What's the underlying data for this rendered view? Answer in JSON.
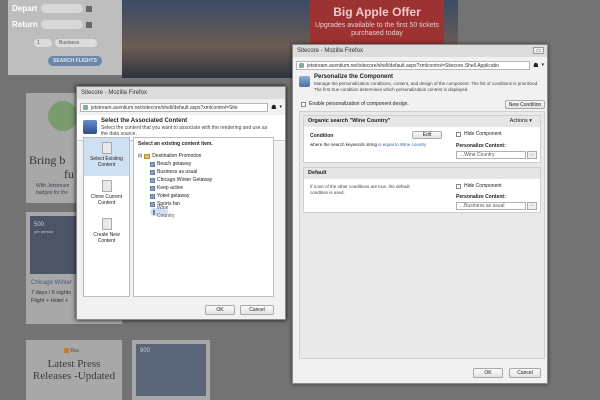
{
  "background": {
    "flight_form": {
      "depart_label": "Depart",
      "return_label": "Return",
      "passengers_value": "1",
      "class_value": "Business",
      "search_button": "SEARCH FLIGHTS"
    },
    "offer": {
      "title": "Big Apple Offer",
      "text": "Upgrades available to the first 50 tickets purchased today"
    },
    "card1": {
      "title_line1": "Bring b",
      "title_line2": "fu",
      "link": "With Jetstream",
      "sub": "badges for the"
    },
    "card2": {
      "price": "500",
      "unit": "per person",
      "title": "Chicago Winter",
      "line1": "7 days / 6 nights",
      "line2": "Flight + Hotel +"
    },
    "press": {
      "rss": "Rss",
      "title": "Latest Press Releases -Updated"
    },
    "card3": {
      "price": "900"
    }
  },
  "associated_dialog": {
    "window_title": "Sitecore - Mozilla Firefox",
    "url": "jetstream.acentium.net/sitecore/shell/default.aspx?xmlcontrol=Site",
    "heading": "Select the Associated Content",
    "description": "Select the content that you want to associate with the rendering and use as the data source.",
    "sidebar": [
      {
        "label": "Select Existing Content",
        "active": true
      },
      {
        "label": "Clone Current Content",
        "active": false
      },
      {
        "label": "Create New Content",
        "active": false
      }
    ],
    "tree_caption": "Select an existing content item.",
    "tree_root": "Destination Promotion",
    "tree_items": [
      "Beach getaway",
      "Business as usual",
      "Chicago Winter Getaway",
      "Keep active",
      "Yoket getaway",
      "Sports fan",
      "Wine Country"
    ],
    "selected_item": "Wine Country",
    "ok_label": "OK",
    "cancel_label": "Cancel"
  },
  "personalize_dialog": {
    "window_title": "Sitecore - Mozilla Firefox",
    "url": "jetstream.acentium.net/sitecore/shell/default.aspx?xmlcontrol=Sitecore.Shell.Applicatio",
    "heading": "Personalize the Component",
    "description": "Manage the personalization conditions, content, and design of the component. The list of conditions is prioritized. The first true condition determines which personalization content is displayed.",
    "enable_label": "Enable personalization of component design.",
    "new_condition_label": "New Condition",
    "rule1": {
      "header": "Organic search \"Wine Country\"",
      "actions_label": "Actions",
      "condition_label": "Condition",
      "edit_label": "Edit",
      "condition_text_prefix": "where the search keywords string",
      "condition_text_link": "is equal to Wine country",
      "hide_label": "Hide Component",
      "content_label": "Personalize Content:",
      "content_value": "...Wine Country"
    },
    "rule2": {
      "header": "Default",
      "text": "If none of the other conditions are true, the default condition is used.",
      "hide_label": "Hide Component",
      "content_label": "Personalize Content:",
      "content_value": "...Business as usual"
    },
    "ok_label": "OK",
    "cancel_label": "Cancel"
  }
}
